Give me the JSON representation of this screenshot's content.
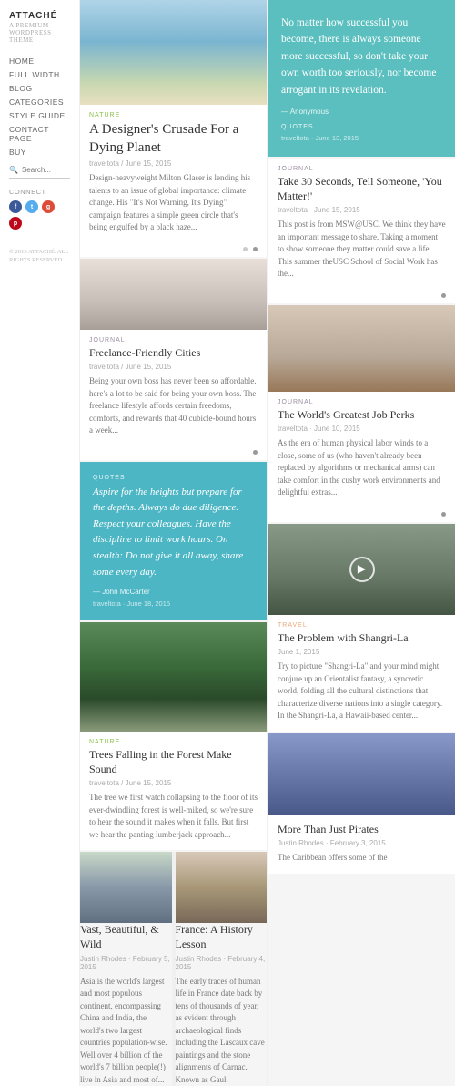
{
  "sidebar": {
    "brand": "ATTACHÉ",
    "tagline": "A PREMIUM WORDPRESS THEME",
    "nav": [
      {
        "label": "HOME"
      },
      {
        "label": "FULL WIDTH"
      },
      {
        "label": "BLOG"
      },
      {
        "label": "CATEGORIES"
      },
      {
        "label": "STYLE GUIDE"
      },
      {
        "label": "CONTACT PAGE"
      },
      {
        "label": "BUY"
      }
    ],
    "search_placeholder": "Search...",
    "connect_label": "CONNECT",
    "social": [
      "f",
      "t",
      "g+",
      "p"
    ],
    "copyright": "© 2015 ATTACHÉ. ALL RIGHTS RESERVED."
  },
  "right_top_quote": {
    "text": "No matter how successful you become, there is always someone more successful, so don't take your own worth too seriously, nor become arrogant in its revelation.",
    "attr": "— Anonymous",
    "tag": "QUOTES",
    "date": "traveltota · June 13, 2015"
  },
  "posts": {
    "designers_crusade": {
      "title": "A Designer's Crusade For a Dying Planet",
      "meta": "traveltota / June 15, 2015",
      "excerpt": "Design-heavyweight Milton Glaser is lending his talents to an issue of global importance: climate change. His \"It's Not Warning, It's Dying\" campaign features a simple green circle that's being engulfed by a black haze...",
      "tag": "NATURE"
    },
    "take_30": {
      "title": "Take 30 Seconds, Tell Someone, 'You Matter!'",
      "meta": "traveltota · June 15, 2015",
      "excerpt": "This post is from MSW@USC. We think they have an important message to share. Taking a moment to show someone they matter could save a life. This summer theUSC School of Social Work has the...",
      "tag": "JOURNAL"
    },
    "freelance_cities": {
      "title": "Freelance-Friendly Cities",
      "meta": "traveltota / June 15, 2015",
      "excerpt": "Being your own boss has never been so affordable. here's a lot to be said for being your own boss. The freelance lifestyle affords certain freedoms, comforts, and rewards that 40 cubicle-bound hours a week...",
      "tag": "JOURNAL"
    },
    "quote_middle": {
      "text": "Aspire for the heights but prepare for the depths. Always do due diligence. Respect your colleagues. Have the discipline to limit work hours. On stealth: Do not give it all away, share some every day.",
      "attr": "— John McCarter",
      "date": "traveltota · June 18, 2015",
      "tag": "QUOTES"
    },
    "job_perks": {
      "title": "The World's Greatest Job Perks",
      "meta": "traveltota · June 10, 2015",
      "excerpt": "As the era of human physical labor winds to a close, some of us (who haven't already been replaced by algorithms or mechanical arms) can take comfort in the cushy work environments and delightful extras...",
      "tag": "JOURNAL"
    },
    "shangri_la": {
      "title": "The Problem with Shangri-La",
      "meta": "June 1, 2015",
      "excerpt": "Try to picture \"Shangri-La\" and your mind might conjure up an Orientalist fantasy, a syncretic world, folding all the cultural distinctions that characterize diverse nations into a single category. In the Shangri-La, a Hawaii-based center...",
      "tag": "TRAVEL"
    },
    "trees_falling": {
      "title": "Trees Falling in the Forest Make Sound",
      "meta": "traveltota / June 15, 2015",
      "excerpt": "The tree we first watch collapsing to the floor of its ever-dwindling forest is well-miked, so we're sure to hear the sound it makes when it falls. But first we hear the panting lumberjack approach...",
      "tag": "NATURE"
    },
    "vast_beautiful": {
      "title": "Vast, Beautiful, & Wild",
      "meta": "Justin Rhodes · February 5, 2015",
      "excerpt": "Asia is the world's largest and most populous continent, encompassing China and India, the world's two largest countries population-wise. Well over 4 billion of the world's 7 billion people(!) live in Asia and most of...",
      "tag": ""
    },
    "france_history": {
      "title": "France: A History Lesson",
      "meta": "Justin Rhodes · February 4, 2015",
      "excerpt": "The early traces of human life in France date back by tens of thousands of year, as evident through archaeological finds including the Lascaux cave paintings and the stone alignments of Carnac. Known as Gaul,",
      "tag": ""
    },
    "pirates": {
      "title": "More Than Just Pirates",
      "meta": "Justin Rhodes · February 3, 2015",
      "excerpt": "The Caribbean offers some of the",
      "tag": ""
    }
  }
}
